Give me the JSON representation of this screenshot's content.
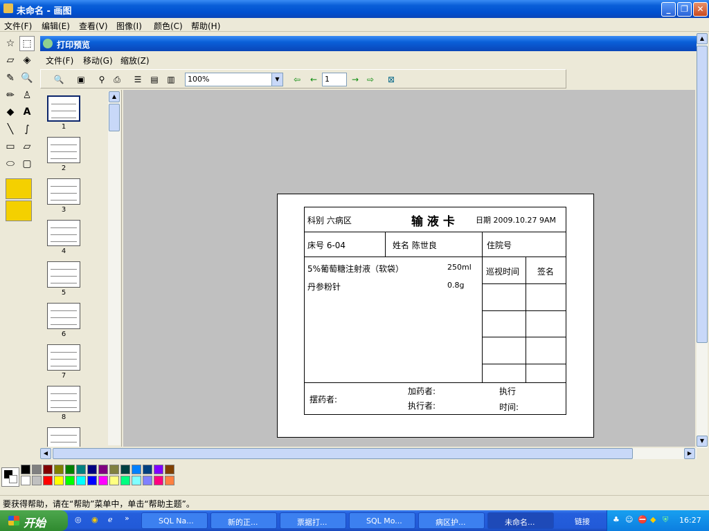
{
  "window": {
    "title": "未命名 - 画图"
  },
  "menu": [
    "文件(F)",
    "编辑(E)",
    "查看(V)",
    "图像(I)",
    "颜色(C)",
    "帮助(H)"
  ],
  "preview": {
    "title": "打印预览",
    "menu": [
      "文件(F)",
      "移动(G)",
      "缩放(Z)"
    ],
    "zoom": "100%",
    "page": "1"
  },
  "thumbnails": [
    "1",
    "2",
    "3",
    "4",
    "5",
    "6",
    "7",
    "8"
  ],
  "card": {
    "dept": "科别 六病区",
    "title": "输 液 卡",
    "date": "日期 2009.10.27 9AM",
    "bed": "床号 6-04",
    "name": "姓名 陈世良",
    "inpatient": "住院号",
    "drug1": "5%葡萄糖注射液（软袋）",
    "drug1_qty": "250ml",
    "drug2": "丹参粉针",
    "drug2_qty": "0.8g",
    "patrol_time": "巡视时间",
    "sign": "签名",
    "dispenser": "摆药者:",
    "adder": "加药者:",
    "executor": "执行者:",
    "exec_time_1": "执行",
    "exec_time_2": "时间:"
  },
  "status": "要获得帮助，请在“帮助”菜单中，单击“帮助主题”。",
  "taskbar": {
    "start": "开始",
    "tasks": [
      "SQL Na...",
      "新的正...",
      "票据打...",
      "SQL Mo...",
      "病区护...",
      "未命名...",
      "链接"
    ],
    "time": "16:27"
  },
  "colors": {
    "row1": [
      "#000000",
      "#808080",
      "#800000",
      "#808000",
      "#008000",
      "#008080",
      "#000080",
      "#800080",
      "#808040",
      "#004040",
      "#0080ff",
      "#004080",
      "#8000ff",
      "#804000"
    ],
    "row2": [
      "#ffffff",
      "#c0c0c0",
      "#ff0000",
      "#ffff00",
      "#00ff00",
      "#00ffff",
      "#0000ff",
      "#ff00ff",
      "#ffff80",
      "#00ff80",
      "#80ffff",
      "#8080ff",
      "#ff0080",
      "#ff8040"
    ]
  }
}
